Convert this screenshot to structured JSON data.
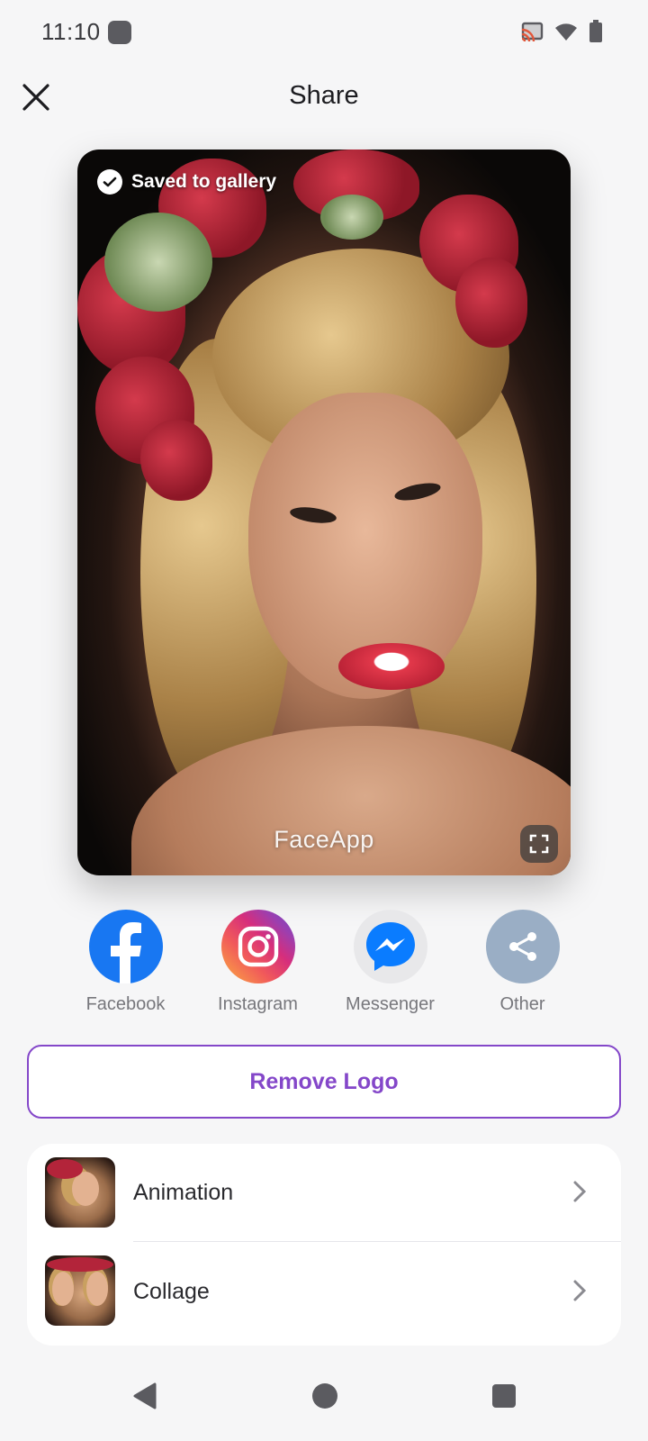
{
  "status_bar": {
    "time": "11:10",
    "icons": [
      "app-notification-icon",
      "cast-icon",
      "wifi-icon",
      "battery-icon"
    ]
  },
  "header": {
    "title": "Share",
    "close_icon": "close-icon"
  },
  "preview": {
    "saved_label": "Saved to gallery",
    "watermark": "FaceApp",
    "expand_icon": "fullscreen-icon"
  },
  "share_targets": [
    {
      "label": "Facebook",
      "icon": "facebook-icon",
      "color": "#1877f2"
    },
    {
      "label": "Instagram",
      "icon": "instagram-icon",
      "color": "#e1306c"
    },
    {
      "label": "Messenger",
      "icon": "messenger-icon",
      "color": "#0a7cff"
    },
    {
      "label": "Other",
      "icon": "share-icon",
      "color": "#9aaec5"
    }
  ],
  "remove_logo": {
    "label": "Remove Logo",
    "color": "#8447c9"
  },
  "options": [
    {
      "label": "Animation",
      "icon": "chevron-right-icon"
    },
    {
      "label": "Collage",
      "icon": "chevron-right-icon"
    }
  ],
  "nav_bar": {
    "icons": [
      "back-icon",
      "home-icon",
      "recents-icon"
    ]
  }
}
